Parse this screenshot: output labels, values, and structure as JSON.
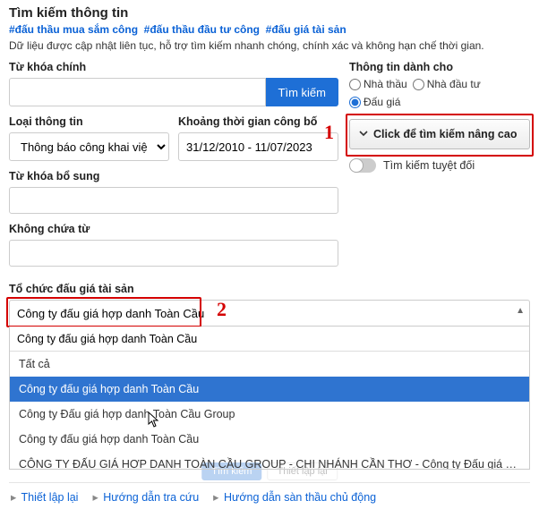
{
  "header": {
    "title": "Tìm kiếm thông tin",
    "tags": [
      "#đấu thầu mua sắm công",
      "#đấu thầu đầu tư công",
      "#đấu giá tài sản"
    ],
    "subtitle": "Dữ liệu được cập nhật liên tục, hỗ trợ tìm kiếm nhanh chóng, chính xác và không hạn chế thời gian."
  },
  "main_keyword": {
    "label": "Từ khóa chính",
    "value": "",
    "search_btn": "Tìm kiếm"
  },
  "info_for": {
    "label": "Thông tin dành cho",
    "options": [
      "Nhà thầu",
      "Nhà đầu tư",
      "Đấu giá"
    ],
    "selected": "Đấu giá"
  },
  "info_type": {
    "label": "Loại thông tin",
    "value": "Thông báo công khai việc"
  },
  "date_range": {
    "label": "Khoảng thời gian công bố",
    "value": "31/12/2010 - 11/07/2023"
  },
  "callouts": {
    "one": "1",
    "two": "2"
  },
  "advanced": {
    "button": "Click để tìm kiếm nâng cao",
    "absolute_toggle": "Tìm kiếm tuyệt đối"
  },
  "extra_keyword": {
    "label": "Từ khóa bổ sung",
    "value": ""
  },
  "exclude": {
    "label": "Không chứa từ",
    "value": ""
  },
  "organization": {
    "label": "Tổ chức đấu giá tài sản",
    "value": "Công ty đấu giá hợp danh Toàn Cầu",
    "search_value": "Công ty đấu giá hợp danh Toàn Cầu",
    "options": [
      "Tất cả",
      "Công ty đấu giá hợp danh Toàn Cầu",
      "Công ty Đấu giá hợp danh Toàn Cầu Group",
      "Công ty đấu giá hợp danh Toàn Cầu",
      "CÔNG TY ĐẤU GIÁ HỢP DANH TOÀN CẦU GROUP - CHI NHÁNH CẦN THƠ - Công ty Đấu giá hợp danh Toàn Cầu Group"
    ],
    "selected_index": 1
  },
  "hidden_actions": {
    "search": "Tìm kiếm",
    "reset": "Thiết lập lại"
  },
  "footer": {
    "reset": "Thiết lập lại",
    "guide": "Hướng dẫn tra cứu",
    "proactive": "Hướng dẫn sàn thầu chủ động"
  }
}
